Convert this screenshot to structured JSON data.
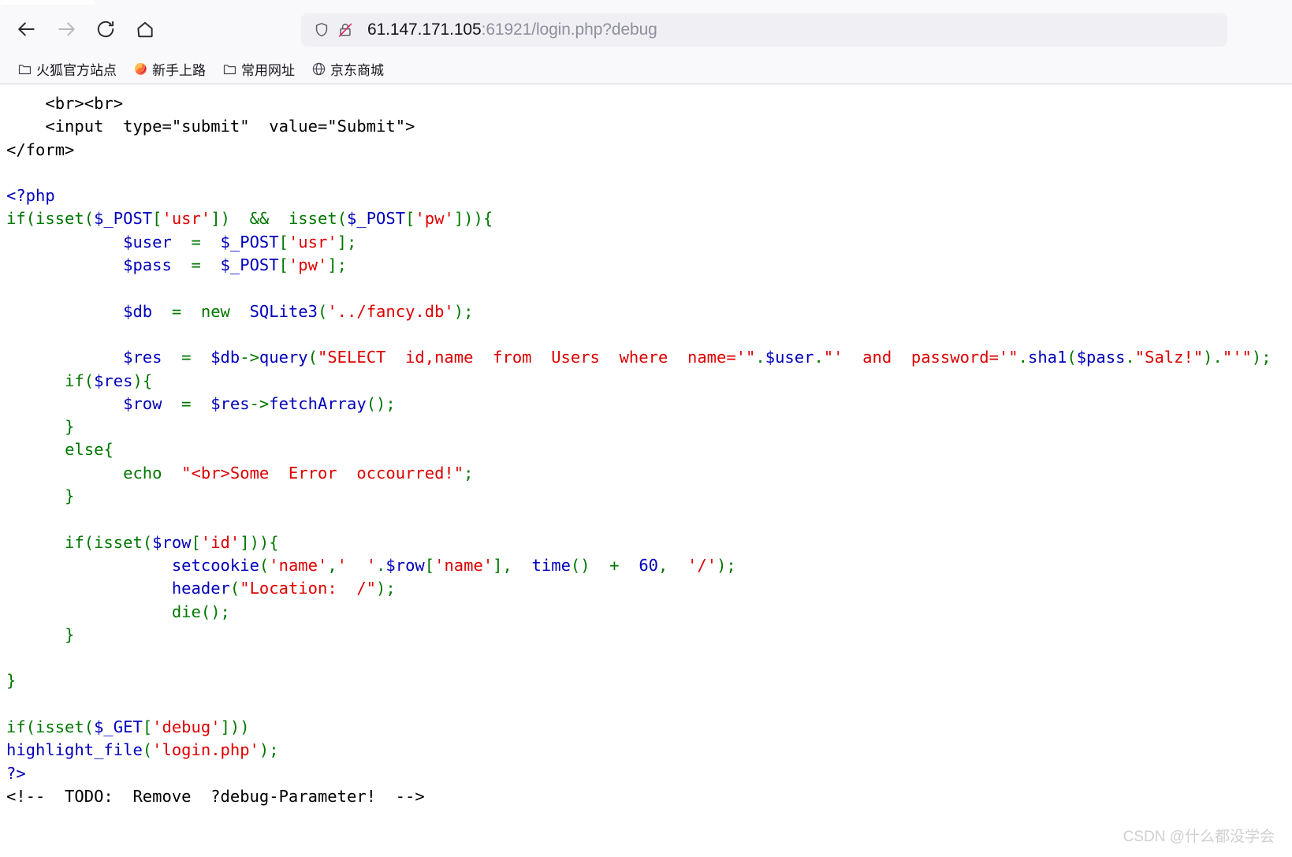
{
  "browser": {
    "toolbar": {
      "back_label": "Back",
      "forward_label": "Forward",
      "reload_label": "Reload",
      "home_label": "Home"
    },
    "address_bar": {
      "shield_icon": "shield-icon",
      "security_icon": "insecure-lock-icon",
      "host": "61.147.171.105",
      "rest": ":61921/login.php?debug",
      "full_url": "61.147.171.105:61921/login.php?debug"
    },
    "bookmarks": [
      {
        "icon": "folder-icon",
        "label": "火狐官方站点"
      },
      {
        "icon": "firefox-logo-icon",
        "label": "新手上路"
      },
      {
        "icon": "folder-icon",
        "label": "常用网址"
      },
      {
        "icon": "globe-icon",
        "label": "京东商城"
      }
    ]
  },
  "page": {
    "source_title": "login.php",
    "watermark": "CSDN @什么都没学会",
    "colors": {
      "default_php": "#0000bb",
      "keyword": "#007700",
      "string": "#dd0000",
      "html": "#000000",
      "comment": "#ff8000"
    },
    "code_lines": [
      {
        "indent": 4,
        "tokens": [
          {
            "t": "<br><br>",
            "c": "html"
          }
        ]
      },
      {
        "indent": 4,
        "tokens": [
          {
            "t": "<input  type=\"submit\"  value=\"Submit\">",
            "c": "html"
          }
        ]
      },
      {
        "indent": 0,
        "tokens": [
          {
            "t": "</form>",
            "c": "html"
          }
        ]
      },
      {
        "indent": 0,
        "tokens": [
          {
            "t": "",
            "c": "html"
          }
        ]
      },
      {
        "indent": 0,
        "tokens": [
          {
            "t": "<?php",
            "c": "def"
          }
        ]
      },
      {
        "indent": 0,
        "tokens": [
          {
            "t": "if",
            "c": "kw"
          },
          {
            "t": "(",
            "c": "kw"
          },
          {
            "t": "isset",
            "c": "kw"
          },
          {
            "t": "(",
            "c": "kw"
          },
          {
            "t": "$_POST",
            "c": "def"
          },
          {
            "t": "[",
            "c": "kw"
          },
          {
            "t": "'usr'",
            "c": "str"
          },
          {
            "t": "]",
            "c": "kw"
          },
          {
            "t": ")  ",
            "c": "kw"
          },
          {
            "t": "&&",
            "c": "kw"
          },
          {
            "t": "  isset",
            "c": "kw"
          },
          {
            "t": "(",
            "c": "kw"
          },
          {
            "t": "$_POST",
            "c": "def"
          },
          {
            "t": "[",
            "c": "kw"
          },
          {
            "t": "'pw'",
            "c": "str"
          },
          {
            "t": "]))",
            "c": "kw"
          },
          {
            "t": "{",
            "c": "kw"
          }
        ]
      },
      {
        "indent": 12,
        "tokens": [
          {
            "t": "$user",
            "c": "def"
          },
          {
            "t": "  =  ",
            "c": "kw"
          },
          {
            "t": "$_POST",
            "c": "def"
          },
          {
            "t": "[",
            "c": "kw"
          },
          {
            "t": "'usr'",
            "c": "str"
          },
          {
            "t": "];",
            "c": "kw"
          }
        ]
      },
      {
        "indent": 12,
        "tokens": [
          {
            "t": "$pass",
            "c": "def"
          },
          {
            "t": "  =  ",
            "c": "kw"
          },
          {
            "t": "$_POST",
            "c": "def"
          },
          {
            "t": "[",
            "c": "kw"
          },
          {
            "t": "'pw'",
            "c": "str"
          },
          {
            "t": "];",
            "c": "kw"
          }
        ]
      },
      {
        "indent": 0,
        "tokens": [
          {
            "t": "",
            "c": "html"
          }
        ]
      },
      {
        "indent": 12,
        "tokens": [
          {
            "t": "$db",
            "c": "def"
          },
          {
            "t": "  =  ",
            "c": "kw"
          },
          {
            "t": "new",
            "c": "kw"
          },
          {
            "t": "  ",
            "c": "kw"
          },
          {
            "t": "SQLite3",
            "c": "def"
          },
          {
            "t": "(",
            "c": "kw"
          },
          {
            "t": "'../fancy.db'",
            "c": "str"
          },
          {
            "t": ");",
            "c": "kw"
          }
        ]
      },
      {
        "indent": 0,
        "tokens": [
          {
            "t": "",
            "c": "html"
          }
        ]
      },
      {
        "indent": 12,
        "tokens": [
          {
            "t": "$res",
            "c": "def"
          },
          {
            "t": "  =  ",
            "c": "kw"
          },
          {
            "t": "$db",
            "c": "def"
          },
          {
            "t": "->",
            "c": "kw"
          },
          {
            "t": "query",
            "c": "def"
          },
          {
            "t": "(",
            "c": "kw"
          },
          {
            "t": "\"SELECT  id,name  from  Users  where  name='\"",
            "c": "str"
          },
          {
            "t": ".",
            "c": "kw"
          },
          {
            "t": "$user",
            "c": "def"
          },
          {
            "t": ".",
            "c": "kw"
          },
          {
            "t": "\"'  and  password='\"",
            "c": "str"
          },
          {
            "t": ".",
            "c": "kw"
          },
          {
            "t": "sha1",
            "c": "def"
          },
          {
            "t": "(",
            "c": "kw"
          },
          {
            "t": "$pass",
            "c": "def"
          },
          {
            "t": ".",
            "c": "kw"
          },
          {
            "t": "\"Salz!\"",
            "c": "str"
          },
          {
            "t": ")",
            "c": "kw"
          },
          {
            "t": ".",
            "c": "kw"
          },
          {
            "t": "\"'\"",
            "c": "str"
          },
          {
            "t": ");",
            "c": "kw"
          }
        ]
      },
      {
        "indent": 6,
        "tokens": [
          {
            "t": "if",
            "c": "kw"
          },
          {
            "t": "(",
            "c": "kw"
          },
          {
            "t": "$res",
            "c": "def"
          },
          {
            "t": ")",
            "c": "kw"
          },
          {
            "t": "{",
            "c": "kw"
          }
        ]
      },
      {
        "indent": 12,
        "tokens": [
          {
            "t": "$row",
            "c": "def"
          },
          {
            "t": "  =  ",
            "c": "kw"
          },
          {
            "t": "$res",
            "c": "def"
          },
          {
            "t": "->",
            "c": "kw"
          },
          {
            "t": "fetchArray",
            "c": "def"
          },
          {
            "t": "();",
            "c": "kw"
          }
        ]
      },
      {
        "indent": 6,
        "tokens": [
          {
            "t": "}",
            "c": "kw"
          }
        ]
      },
      {
        "indent": 6,
        "tokens": [
          {
            "t": "else",
            "c": "kw"
          },
          {
            "t": "{",
            "c": "kw"
          }
        ]
      },
      {
        "indent": 12,
        "tokens": [
          {
            "t": "echo",
            "c": "kw"
          },
          {
            "t": "  ",
            "c": "kw"
          },
          {
            "t": "\"<br>Some  Error  occourred!\"",
            "c": "str"
          },
          {
            "t": ";",
            "c": "kw"
          }
        ]
      },
      {
        "indent": 6,
        "tokens": [
          {
            "t": "}",
            "c": "kw"
          }
        ]
      },
      {
        "indent": 0,
        "tokens": [
          {
            "t": "",
            "c": "html"
          }
        ]
      },
      {
        "indent": 6,
        "tokens": [
          {
            "t": "if",
            "c": "kw"
          },
          {
            "t": "(",
            "c": "kw"
          },
          {
            "t": "isset",
            "c": "kw"
          },
          {
            "t": "(",
            "c": "kw"
          },
          {
            "t": "$row",
            "c": "def"
          },
          {
            "t": "[",
            "c": "kw"
          },
          {
            "t": "'id'",
            "c": "str"
          },
          {
            "t": "]))",
            "c": "kw"
          },
          {
            "t": "{",
            "c": "kw"
          }
        ]
      },
      {
        "indent": 17,
        "tokens": [
          {
            "t": "setcookie",
            "c": "def"
          },
          {
            "t": "(",
            "c": "kw"
          },
          {
            "t": "'name'",
            "c": "str"
          },
          {
            "t": ",",
            "c": "kw"
          },
          {
            "t": "'  '",
            "c": "str"
          },
          {
            "t": ".",
            "c": "kw"
          },
          {
            "t": "$row",
            "c": "def"
          },
          {
            "t": "[",
            "c": "kw"
          },
          {
            "t": "'name'",
            "c": "str"
          },
          {
            "t": "],  ",
            "c": "kw"
          },
          {
            "t": "time",
            "c": "def"
          },
          {
            "t": "()  +  ",
            "c": "kw"
          },
          {
            "t": "60",
            "c": "def"
          },
          {
            "t": ",  ",
            "c": "kw"
          },
          {
            "t": "'/'",
            "c": "str"
          },
          {
            "t": ");",
            "c": "kw"
          }
        ]
      },
      {
        "indent": 17,
        "tokens": [
          {
            "t": "header",
            "c": "def"
          },
          {
            "t": "(",
            "c": "kw"
          },
          {
            "t": "\"Location:  /\"",
            "c": "str"
          },
          {
            "t": ");",
            "c": "kw"
          }
        ]
      },
      {
        "indent": 17,
        "tokens": [
          {
            "t": "die",
            "c": "kw"
          },
          {
            "t": "();",
            "c": "kw"
          }
        ]
      },
      {
        "indent": 6,
        "tokens": [
          {
            "t": "}",
            "c": "kw"
          }
        ]
      },
      {
        "indent": 0,
        "tokens": [
          {
            "t": "",
            "c": "html"
          }
        ]
      },
      {
        "indent": 0,
        "tokens": [
          {
            "t": "}",
            "c": "kw"
          }
        ]
      },
      {
        "indent": 0,
        "tokens": [
          {
            "t": "",
            "c": "html"
          }
        ]
      },
      {
        "indent": 0,
        "tokens": [
          {
            "t": "if",
            "c": "kw"
          },
          {
            "t": "(",
            "c": "kw"
          },
          {
            "t": "isset",
            "c": "kw"
          },
          {
            "t": "(",
            "c": "kw"
          },
          {
            "t": "$_GET",
            "c": "def"
          },
          {
            "t": "[",
            "c": "kw"
          },
          {
            "t": "'debug'",
            "c": "str"
          },
          {
            "t": "]))",
            "c": "kw"
          }
        ]
      },
      {
        "indent": 0,
        "tokens": [
          {
            "t": "highlight_file",
            "c": "def"
          },
          {
            "t": "(",
            "c": "kw"
          },
          {
            "t": "'login.php'",
            "c": "str"
          },
          {
            "t": ");",
            "c": "kw"
          }
        ]
      },
      {
        "indent": 0,
        "tokens": [
          {
            "t": "?>",
            "c": "def"
          }
        ]
      },
      {
        "indent": 0,
        "tokens": [
          {
            "t": "<!--  TODO:  Remove  ?debug-Parameter!  -->",
            "c": "html"
          }
        ]
      }
    ]
  }
}
